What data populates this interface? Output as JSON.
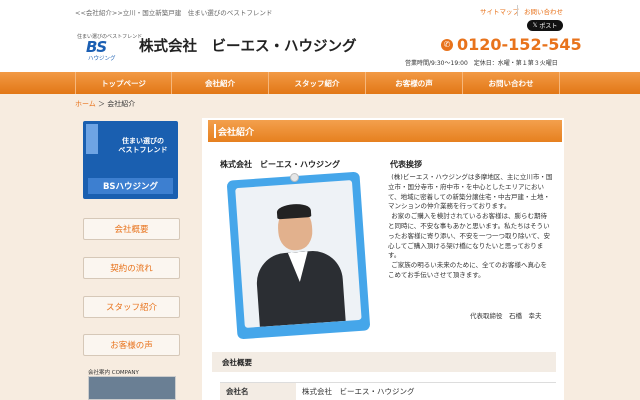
{
  "header": {
    "top_text": "<<会社紹介>>立川・国立新築戸建　住まい選びのベストフレンド",
    "links": {
      "sitemap": "サイトマップ",
      "contact": "お問い合わせ"
    },
    "x_post": "ポスト",
    "logo": {
      "tagline": "住まい選びのベストフレンド",
      "mark": "BS",
      "sub": "ハウジング"
    },
    "company_name": "株式会社　ビーエス・ハウジング",
    "phone": "0120-152-545",
    "hours": "営業時間/9:30～19:00　定休日：水曜・第１第３火曜日"
  },
  "nav": {
    "items": [
      "トップページ",
      "会社紹介",
      "スタッフ紹介",
      "お客様の声",
      "お問い合わせ"
    ]
  },
  "breadcrumb": {
    "home": "ホーム",
    "sep": "＞",
    "current": "会社紹介"
  },
  "sidebar": {
    "banner": {
      "title": "住まい選びの\nベストフレンド",
      "label": "BSハウジング"
    },
    "buttons": [
      "会社概要",
      "契約の流れ",
      "スタッフ紹介",
      "お客様の声"
    ],
    "image_label": "会社案内 COMPANY"
  },
  "main": {
    "section_title": "会社紹介",
    "company_label": "株式会社　ビーエス・ハウジング",
    "greeting_title": "代表挨拶",
    "greeting_p1": "(株)ビーエス・ハウジングは多摩地区、主に立川市・国立市・国分寺市・府中市・を中心としたエリアにおいて、地域に密着しての新築分譲住宅・中古戸建・土地・マンションの仲介業務を行っております。",
    "greeting_p2": "お家のご購入を検討されているお客様は、膨らむ期待と同時に、不安な事もあかと思います。私たちはそういったお客様に寄り添い、不安を一つ一つ取り除いて、安心してご購入頂ける架け橋になりたいと思っております。",
    "greeting_p3": "ご家族の明るい未来のために、全てのお客様へ真心をこめてお手伝いさせて頂きます。",
    "signer": "代表取締役　石橋　幸夫",
    "overview_title": "会社概要",
    "overview_rows": [
      {
        "label": "会社名",
        "value": "株式会社　ビーエス・ハウジング"
      }
    ]
  },
  "colors": {
    "accent": "#e8731c",
    "brand_blue": "#1a5fb0",
    "background": "#f7ece0"
  }
}
